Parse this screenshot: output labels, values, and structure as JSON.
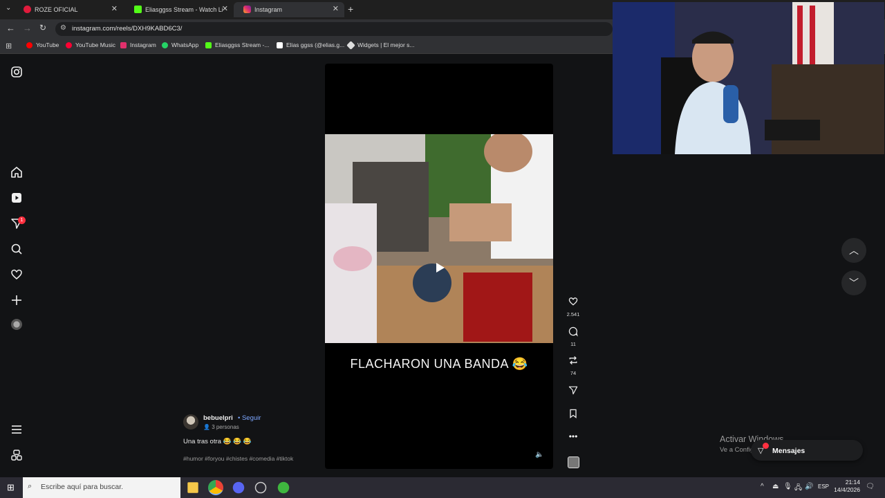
{
  "browser": {
    "tabs": [
      {
        "label": "ROZE OFICIAL",
        "favicon": "youtube-icon"
      },
      {
        "label": "Eliasggss Stream - Watch Live o",
        "favicon": "kick-icon"
      },
      {
        "label": "Instagram",
        "favicon": "instagram-icon",
        "active": true
      }
    ],
    "url": "instagram.com/reels/DXH9KABD6C3/",
    "bookmarks": [
      {
        "label": "YouTube",
        "icon": "youtube-icon",
        "color": "#ff0000"
      },
      {
        "label": "YouTube Music",
        "icon": "youtube-music-icon",
        "color": "#ff0033"
      },
      {
        "label": "Instagram",
        "icon": "instagram-icon",
        "color": "#e1306c"
      },
      {
        "label": "WhatsApp",
        "icon": "whatsapp-icon",
        "color": "#25d366"
      },
      {
        "label": "Eliasggss Stream -...",
        "icon": "kick-icon",
        "color": "#53fc18"
      },
      {
        "label": "Elias ggss (@elias.g...",
        "icon": "tiktok-icon",
        "color": "#ffffff"
      },
      {
        "label": "Widgets | El mejor s...",
        "icon": "widgets-icon",
        "color": "#dddddd"
      }
    ]
  },
  "reel": {
    "overlay_text": "FLACHARON UNA BANDA 😂",
    "likes": "2.541",
    "comments": "11",
    "reposts": "74",
    "author": "bebuelpri",
    "follow_label": "Seguir",
    "audience": "3 personas",
    "caption": "Una tras otra 😂 😂 😂",
    "hashtags": "#humor #foryou #chistes #comedia #tiktok"
  },
  "sidebar_badge": "1",
  "windows": {
    "activate_title": "Activar Windows",
    "activate_sub": "Ve a Configuración para activar Windows.",
    "messages_label": "Mensajes",
    "search_placeholder": "Escribe aquí para buscar.",
    "lang": "ESP",
    "time": "21:14",
    "date": "14/4/2026"
  },
  "colors": {
    "accent_link": "#7da7ff",
    "notification": "#ff3040"
  }
}
